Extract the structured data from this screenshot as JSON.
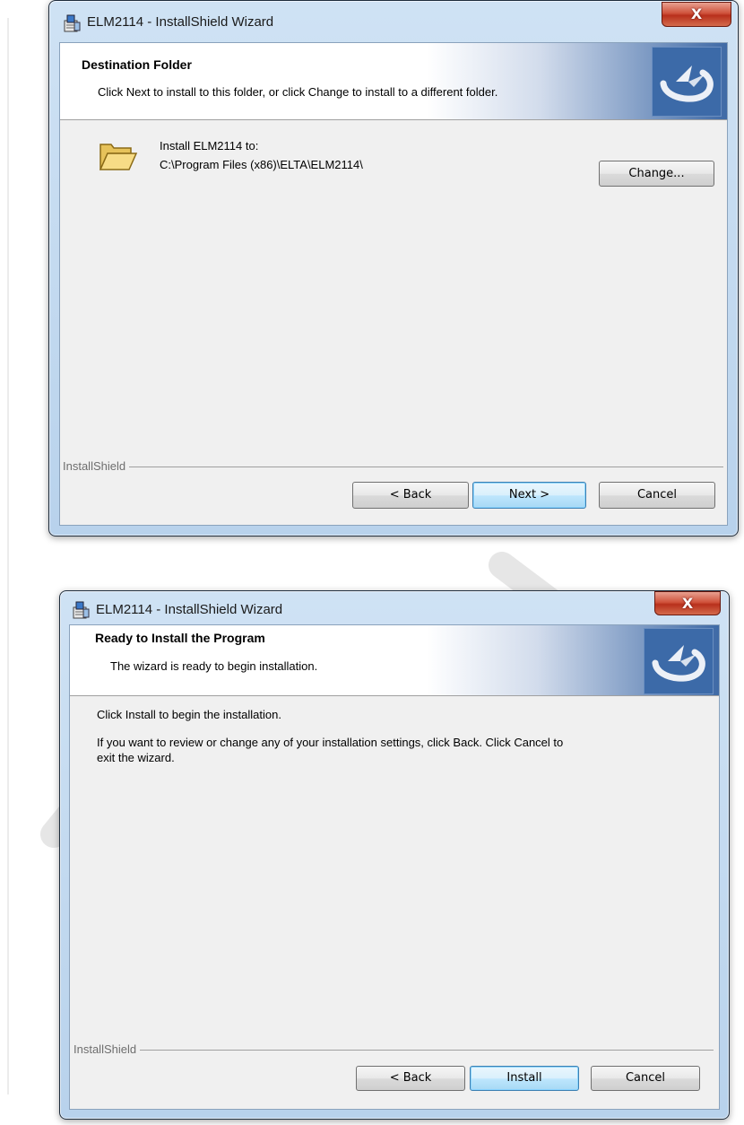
{
  "dialogs": [
    {
      "title": "ELM2114  - InstallShield Wizard",
      "close_label": "X",
      "banner_title": "Destination Folder",
      "banner_subtitle": "Click Next to install to this folder, or click Change to install to a different folder.",
      "install_label": "Install ELM2114  to:",
      "install_path": "C:\\Program Files (x86)\\ELTA\\ELM2114\\",
      "change_button": "Change...",
      "footer_brand": "InstallShield",
      "buttons": {
        "back": "< Back",
        "next": "Next >",
        "cancel": "Cancel"
      }
    },
    {
      "title": "ELM2114  - InstallShield Wizard",
      "close_label": "X",
      "banner_title": "Ready to Install the Program",
      "banner_subtitle": "The wizard is ready to begin installation.",
      "line1": "Click Install to begin the installation.",
      "line2": "If you want to review or change any of your installation settings, click Back. Click Cancel to",
      "line3": "exit the wizard.",
      "footer_brand": "InstallShield",
      "buttons": {
        "back": "< Back",
        "install": "Install",
        "cancel": "Cancel"
      }
    }
  ],
  "icons": {
    "app": "installer-icon",
    "folder": "folder-open-icon",
    "logo": "installshield-logo"
  },
  "colors": {
    "client_bg": "#f0f0f0",
    "banner_accent": "#3c6aa8",
    "frame": "#c4dbf0",
    "close": "#c8462e"
  }
}
